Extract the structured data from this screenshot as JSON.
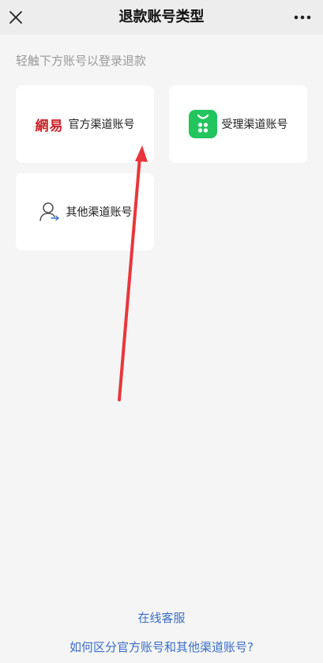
{
  "header": {
    "title": "退款账号类型"
  },
  "hint": "轻触下方账号以登录退款",
  "cards": {
    "official": {
      "logo_text": "網易",
      "label": "官方渠道账号"
    },
    "agent": {
      "label": "受理渠道账号",
      "logo_color": "#22c45e"
    },
    "other": {
      "label": "其他渠道账号"
    }
  },
  "links": {
    "service": "在线客服",
    "difference": "如何区分官方账号和其他渠道账号?"
  },
  "colors": {
    "link": "#3b6dc5",
    "arrow": "#e8373a",
    "brand_red": "#c9242b"
  }
}
